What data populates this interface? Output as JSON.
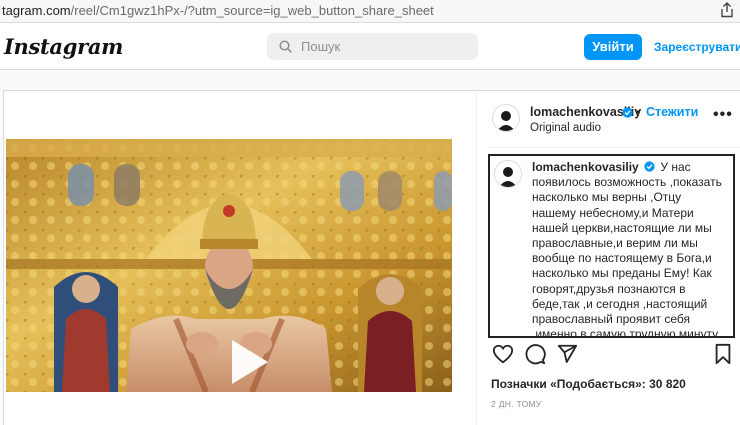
{
  "browser": {
    "url_host": "tagram.com",
    "url_path": "/reel/Cm1gwz1hPx-/?utm_source=ig_web_button_share_sheet"
  },
  "header": {
    "logo": "Instagram",
    "search_placeholder": "Пошук",
    "login_label": "Увійти",
    "signup_label": "Зареєструватися"
  },
  "post": {
    "username": "lomachenkovasiliy",
    "follow_label": "Стежити",
    "audio_label": "Original audio",
    "caption_text": "У нас появилось возможность ,показать насколько мы верны ,Отцу нашему небесному,и Матери нашей церкви,настоящие ли мы православные,и верим ли мы вообще по настоящему в Бога,и насколько мы преданы Ему! Как говорят,друзья познаются в беде,так ,и сегодня ,настоящий православный проявит себя ,именно в самую трудную минуту",
    "likes_text": "Позначки «Подобається»: 30 820",
    "time_ago": "2 ДН. ТОМУ"
  },
  "colors": {
    "accent": "#0095f6",
    "border": "#dbdbdb",
    "text": "#262626",
    "muted": "#8e8e8e"
  },
  "icons": [
    "share-icon",
    "search-icon",
    "verified-badge-icon",
    "more-options-icon",
    "play-icon",
    "heart-icon",
    "comment-icon",
    "send-icon",
    "bookmark-icon"
  ]
}
